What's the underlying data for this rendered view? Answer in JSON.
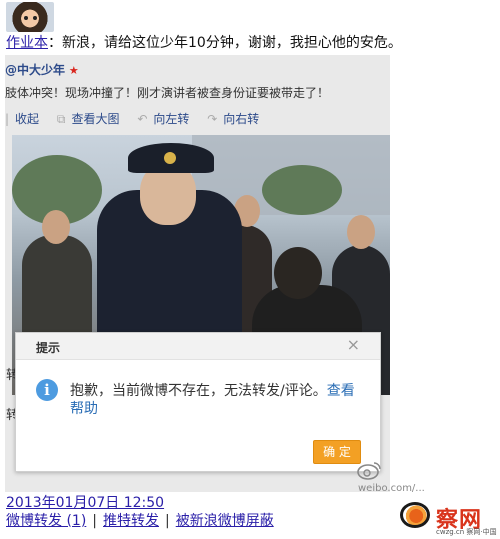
{
  "post": {
    "author": "作业本",
    "colon": "：",
    "message": "新浪，请给这位少年10分钟，谢谢，我担心他的安危。"
  },
  "embedded": {
    "handle": "@中大少年",
    "text": "肢体冲突！现场冲撞了！刚才演讲者被查身份证要被带走了！",
    "toolbar": [
      "收起",
      "查看大图",
      "向左转",
      "向右转"
    ]
  },
  "dialog": {
    "title": "提示",
    "close": "×",
    "message": "抱歉，当前微博不存在，无法转发/评论。",
    "link": "查看帮助",
    "confirm": "确 定"
  },
  "cut_chars": [
    "转",
    "转"
  ],
  "footer": {
    "date": "2013年01月07日  12:50",
    "actions": [
      "微博转发 (1)",
      "推特转发",
      "被新浪微博屏蔽"
    ]
  },
  "watermark": {
    "url": "weibo.com/..."
  },
  "logo": {
    "brand": "察网",
    "sub": "cwzg.cn  察网·中国"
  },
  "colors": {
    "link": "#2a1fa8",
    "confirm": "#f3a024",
    "info": "#4d9be0"
  },
  "icons": [
    "avatar",
    "verified-badge",
    "zoom-icon",
    "rotate-left-icon",
    "rotate-right-icon",
    "info-icon",
    "close-icon",
    "weibo-icon",
    "eye-logo"
  ]
}
